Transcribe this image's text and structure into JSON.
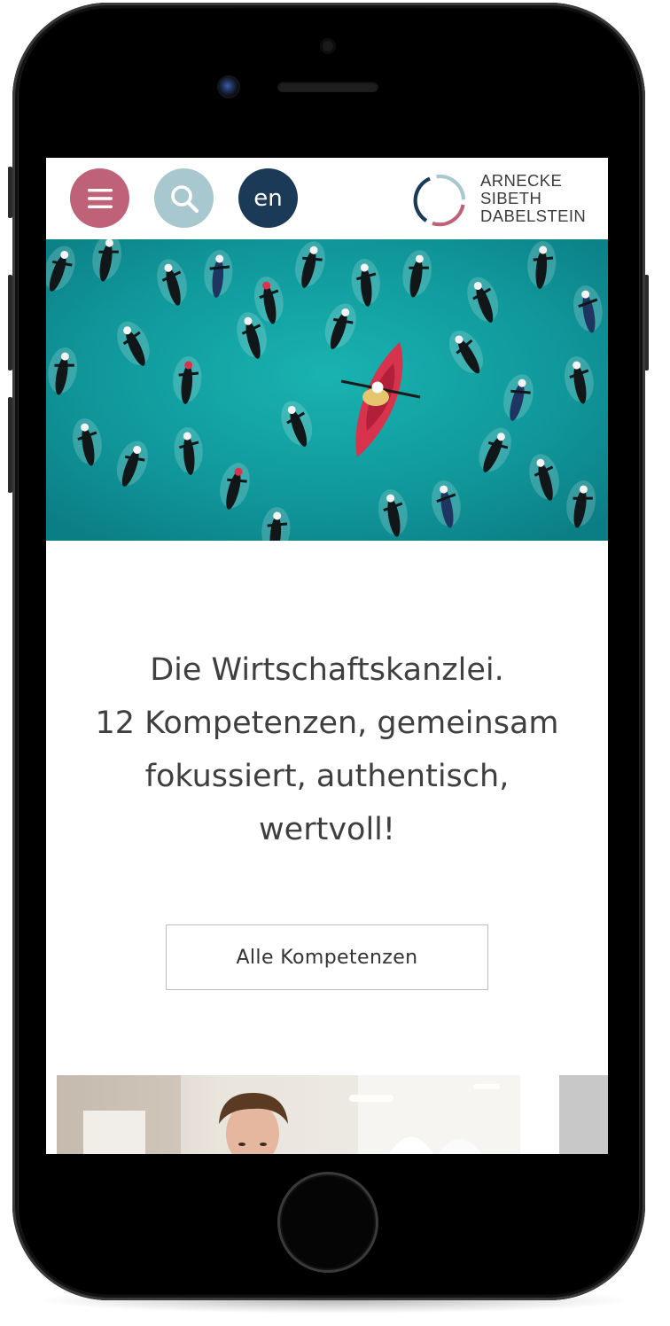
{
  "header": {
    "menu_icon": "hamburger-icon",
    "search_icon": "search-icon",
    "language_label": "en",
    "logo_lines": [
      "ARNECKE",
      "SIBETH",
      "DABELSTEIN"
    ]
  },
  "hero": {
    "image": "aerial-view-swimmers-with-red-kayak"
  },
  "intro": {
    "lines": [
      "Die Wirtschaftskanzlei.",
      "12 Kompetenzen, gemeinsam",
      "fokussiert, authentisch,",
      "wertvoll!"
    ],
    "cta_label": "Alle Kompetenzen"
  },
  "cards": {
    "photo": "portrait-man-office"
  },
  "colors": {
    "menu_button": "#c06277",
    "search_button": "#a9c7cf",
    "language_button": "#1b3a58",
    "water": "#14a3a3",
    "kayak": "#d8334d",
    "text": "#3f3f3f"
  }
}
